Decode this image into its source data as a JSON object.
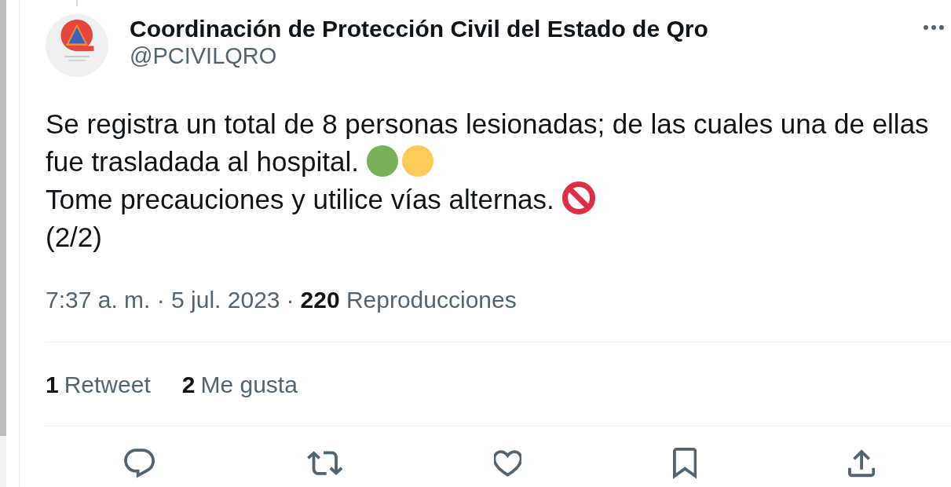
{
  "tweet": {
    "author": {
      "name": "Coordinación de Protección Civil del Estado de Qro",
      "handle": "@PCIVILQRO"
    },
    "body": [
      {
        "text": "Se registra un total de 8 personas lesionadas; de las cuales una de ellas fue trasladada al hospital.",
        "emojis": [
          {
            "kind": "circle",
            "color": "#78b159"
          },
          {
            "kind": "circle",
            "color": "#fdcb58"
          }
        ]
      },
      {
        "text": "Tome precauciones y utilice vías alternas.",
        "emojis": [
          {
            "kind": "prohibited"
          }
        ]
      },
      {
        "text": "(2/2)"
      }
    ],
    "meta": {
      "timestamp": "7:37 a. m. · 5 jul. 2023",
      "separator": "·",
      "views": "**220** Reproducciones"
    },
    "stats": [
      {
        "count": "1",
        "label": "Retweet"
      },
      {
        "count": "2",
        "label": "Me gusta"
      }
    ],
    "actions": [
      {
        "kind": "reply"
      },
      {
        "kind": "retweet"
      },
      {
        "kind": "like"
      },
      {
        "kind": "bookmark"
      },
      {
        "kind": "share"
      }
    ]
  }
}
